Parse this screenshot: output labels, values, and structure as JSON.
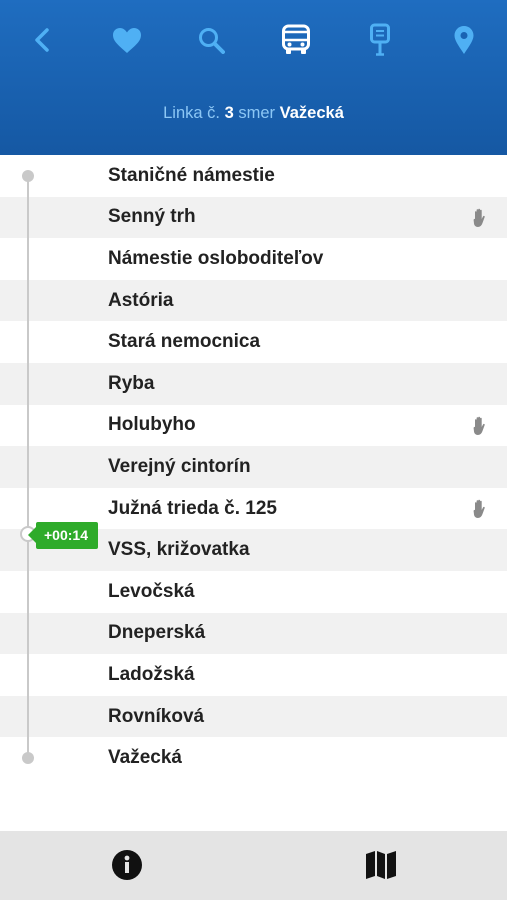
{
  "header": {
    "title_prefix": "Linka č.",
    "line_number": "3",
    "direction_word": "smer",
    "destination": "Važecká",
    "nav_icons": [
      "back-icon",
      "favorites-icon",
      "search-icon",
      "bus-icon",
      "stop-sign-icon",
      "location-icon"
    ]
  },
  "stops": [
    {
      "name": "Staničné námestie",
      "on_request": false
    },
    {
      "name": "Senný trh",
      "on_request": true
    },
    {
      "name": "Námestie osloboditeľov",
      "on_request": false
    },
    {
      "name": "Astória",
      "on_request": false
    },
    {
      "name": "Stará nemocnica",
      "on_request": false
    },
    {
      "name": "Ryba",
      "on_request": false
    },
    {
      "name": "Holubyho",
      "on_request": true
    },
    {
      "name": "Verejný cintorín",
      "on_request": false
    },
    {
      "name": "Južná trieda č. 125",
      "on_request": true
    },
    {
      "name": "VSS, križovatka",
      "on_request": false
    },
    {
      "name": "Levočská",
      "on_request": false
    },
    {
      "name": "Dneperská",
      "on_request": false
    },
    {
      "name": "Ladožská",
      "on_request": false
    },
    {
      "name": "Rovníková",
      "on_request": false
    },
    {
      "name": "Važecká",
      "on_request": false
    }
  ],
  "vehicle": {
    "delay": "+00:14",
    "badge_color": "#2eab2a"
  },
  "footer": {
    "icons": [
      "info-icon",
      "map-icon"
    ]
  },
  "colors": {
    "header": "#1a63b3",
    "title_prefix": "#8cc7f5",
    "delay": "#2eab2a"
  }
}
